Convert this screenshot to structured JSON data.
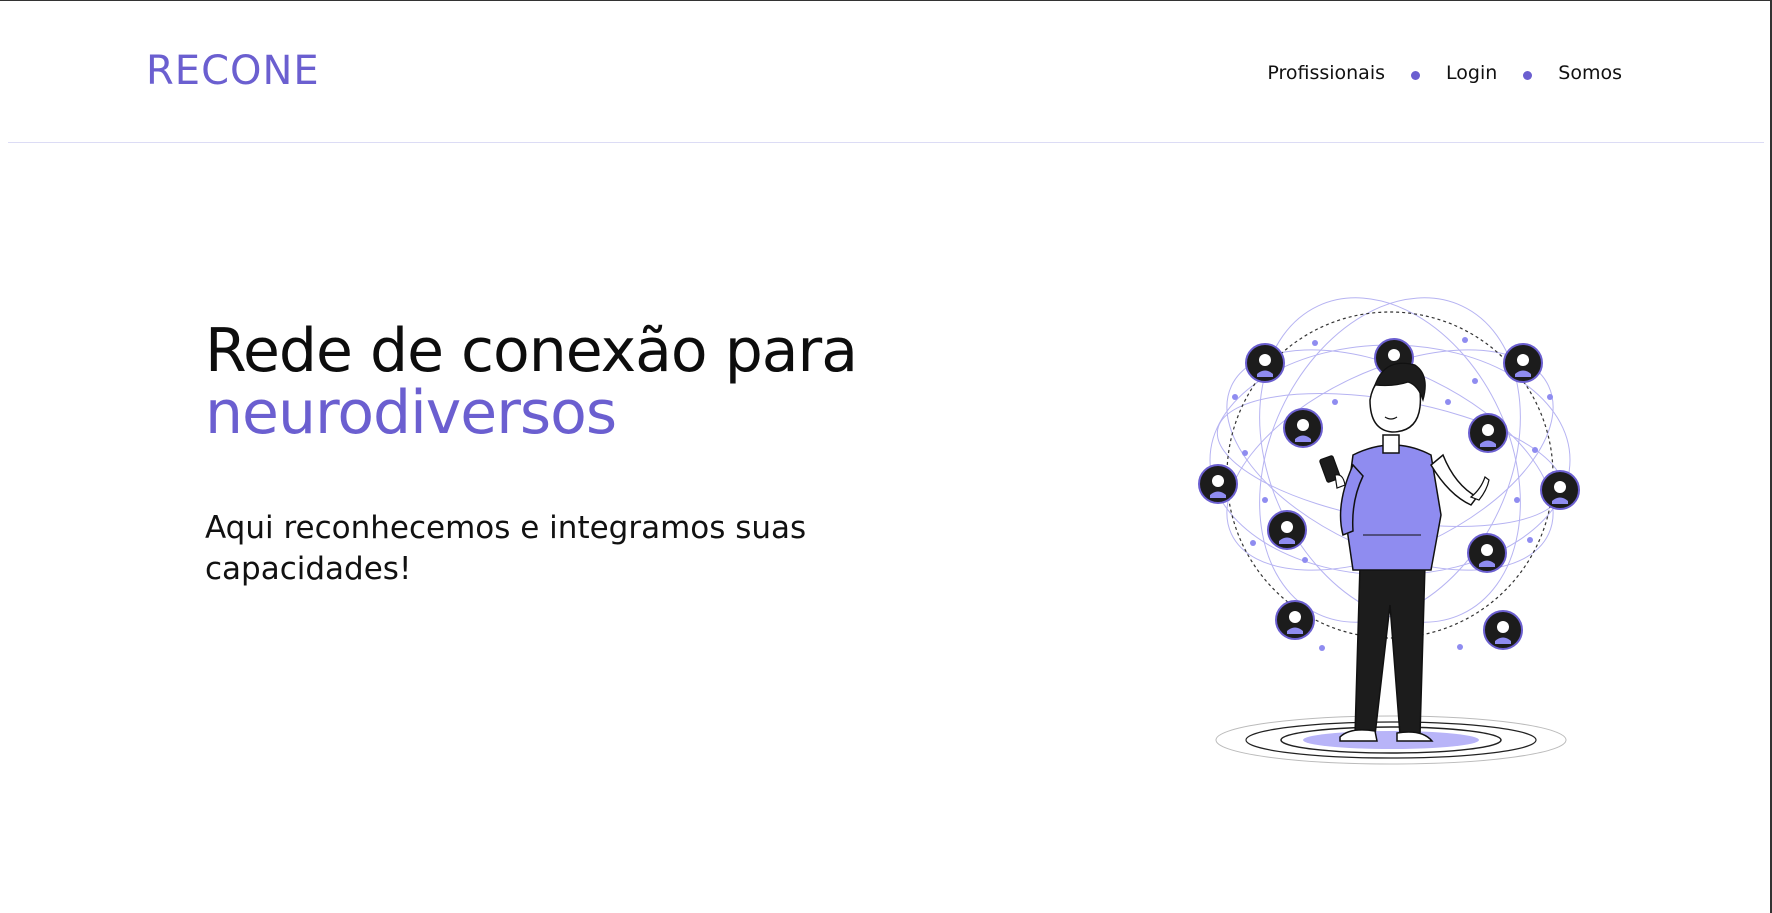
{
  "header": {
    "logo": "RECONE",
    "nav": [
      {
        "label": "Profissionais"
      },
      {
        "label": "Login"
      },
      {
        "label": "Somos"
      }
    ]
  },
  "hero": {
    "title_line1": "Rede de conexão para",
    "title_line2": "neurodiversos",
    "subtitle": "Aqui reconhecemos e integramos suas capacidades!"
  },
  "illustration": {
    "icon": "person-network-illustration",
    "accent_color": "#6b5fd0",
    "secondary_color": "#8f8cf0"
  },
  "colors": {
    "accent": "#6b5fd0",
    "text": "#111111",
    "divider": "#dcdcf5"
  }
}
